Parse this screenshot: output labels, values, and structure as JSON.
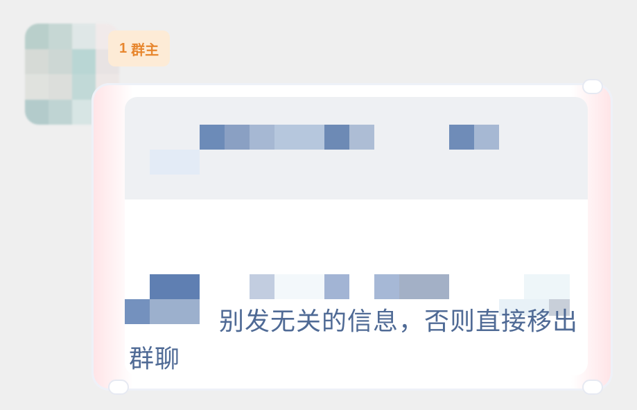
{
  "badge": {
    "level": "1",
    "role": "群主"
  },
  "message": {
    "text": "别发无关的信息，否则直接移出群聊"
  },
  "colors": {
    "background": "#efefef",
    "badge_bg": "#fdebd6",
    "badge_text": "#e7862e",
    "message_text": "#4f6a95"
  },
  "icons": {
    "avatar": "blurred-avatar",
    "redaction": "pixelated-redaction"
  }
}
